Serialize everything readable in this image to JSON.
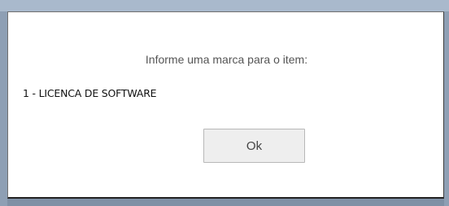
{
  "dialog": {
    "prompt": "Informe uma marca para o item:",
    "item_line": "1 - LICENCA DE SOFTWARE",
    "ok_label": "Ok"
  },
  "colors": {
    "backdrop": "#9fb0c4",
    "dialog_bg": "#ffffff",
    "button_bg": "#eeeeee",
    "button_border": "#b8b8b8"
  }
}
